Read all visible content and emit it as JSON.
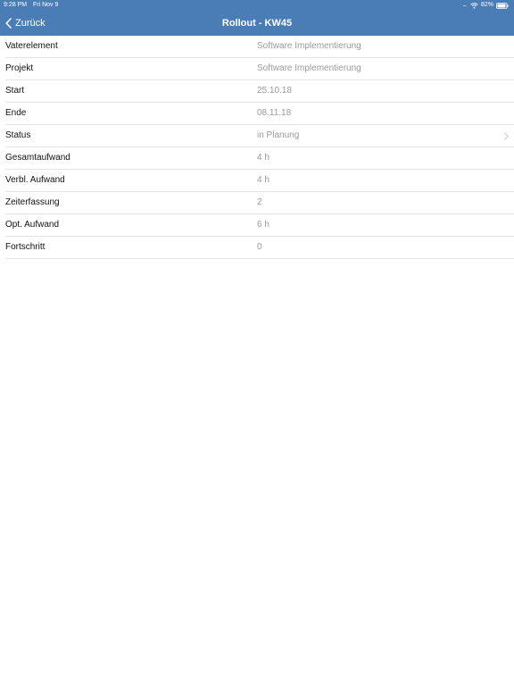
{
  "status_bar": {
    "time": "9:28 PM",
    "date": "Fri Nov 9",
    "signal": ".....",
    "battery_percent": "82%"
  },
  "nav": {
    "back_label": "Zurück",
    "title": "Rollout - KW45",
    "color": "#4a7db5"
  },
  "rows": [
    {
      "label": "Vaterelement",
      "value": "Software Implementierung"
    },
    {
      "label": "Projekt",
      "value": "Software Implementierung"
    },
    {
      "label": "Start",
      "value": "25.10.18"
    },
    {
      "label": "Ende",
      "value": "08.11.18"
    },
    {
      "label": "Status",
      "value": "in Planung",
      "disclosure": "chevron-right-icon"
    },
    {
      "label": "Gesamtaufwand",
      "value": "4 h"
    },
    {
      "label": "Verbl. Aufwand",
      "value": "4 h"
    },
    {
      "label": "Zeiterfassung",
      "value": "2"
    },
    {
      "label": "Opt. Aufwand",
      "value": "6 h"
    },
    {
      "label": "Fortschritt",
      "value": "0"
    }
  ]
}
